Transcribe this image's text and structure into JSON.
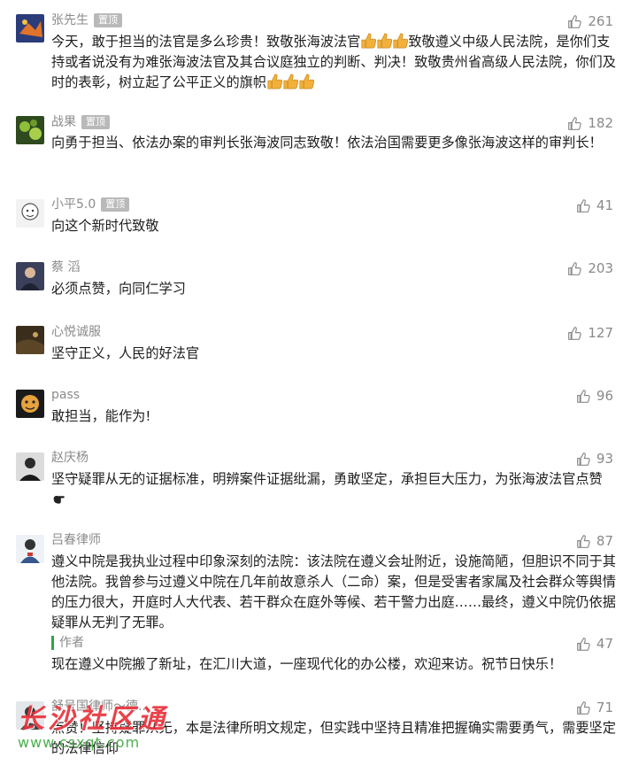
{
  "pinned_label": "置顶",
  "author_label": "作者",
  "comments": [
    {
      "name": "张先生",
      "pinned": true,
      "likes": "261",
      "text_a": "今天，敢于担当的法官是多么珍贵！致敬张海波法官",
      "text_b": "致敬遵义中级人民法院，是你们支持或者说没有为难张海波法官及其合议庭独立的判断、判决！致敬贵州省高级人民法院，你们及时的表彰，树立起了公平正义的旗帜"
    },
    {
      "name": "战果",
      "pinned": true,
      "likes": "182",
      "text": "向勇于担当、依法办案的审判长张海波同志致敬！依法治国需要更多像张海波这样的审判长！"
    },
    {
      "name": "小平5.0",
      "pinned": true,
      "likes": "41",
      "text": "向这个新时代致敬"
    },
    {
      "name": "蔡 滔",
      "pinned": false,
      "likes": "203",
      "text": "必须点赞，向同仁学习"
    },
    {
      "name": "心悦诚服",
      "pinned": false,
      "likes": "127",
      "text": "坚守正义，人民的好法官"
    },
    {
      "name": "pass",
      "pinned": false,
      "likes": "96",
      "text": "敢担当，能作为!"
    },
    {
      "name": "赵庆杨",
      "pinned": false,
      "likes": "93",
      "text": "坚守疑罪从无的证据标准，明辨案件证据纰漏，勇敢坚定，承担巨大压力，为张海波法官点赞"
    },
    {
      "name": "吕春律师",
      "pinned": false,
      "likes": "87",
      "text": "遵义中院是我执业过程中印象深刻的法院：该法院在遵义会址附近，设施简陋，但胆识不同于其他法院。我曾参与过遵义中院在几年前故意杀人（二命）案，但是受害者家属及社会群众等舆情的压力很大，开庭时人大代表、若干群众在庭外等候、若干警力出庭……最终，遵义中院仍依据疑罪从无判了无罪。",
      "reply": {
        "likes": "47",
        "text": "现在遵义中院搬了新址，在汇川大道，一座现代化的办公楼，欢迎来访。祝节日快乐！"
      }
    },
    {
      "name": "舒号国律师～德...",
      "pinned": false,
      "likes": "71",
      "text": "点赞！坚持疑罪从无，本是法律所明文规定，但实践中坚持且精准把握确实需要勇气，需要坚定的法律信仰"
    }
  ],
  "watermark": {
    "main": "长沙社区通",
    "url": "www.csxqt.com"
  },
  "colors": {
    "accent_green": "#2fa24a",
    "watermark_red": "#e8323c",
    "meta_gray": "#8a8a8a"
  }
}
